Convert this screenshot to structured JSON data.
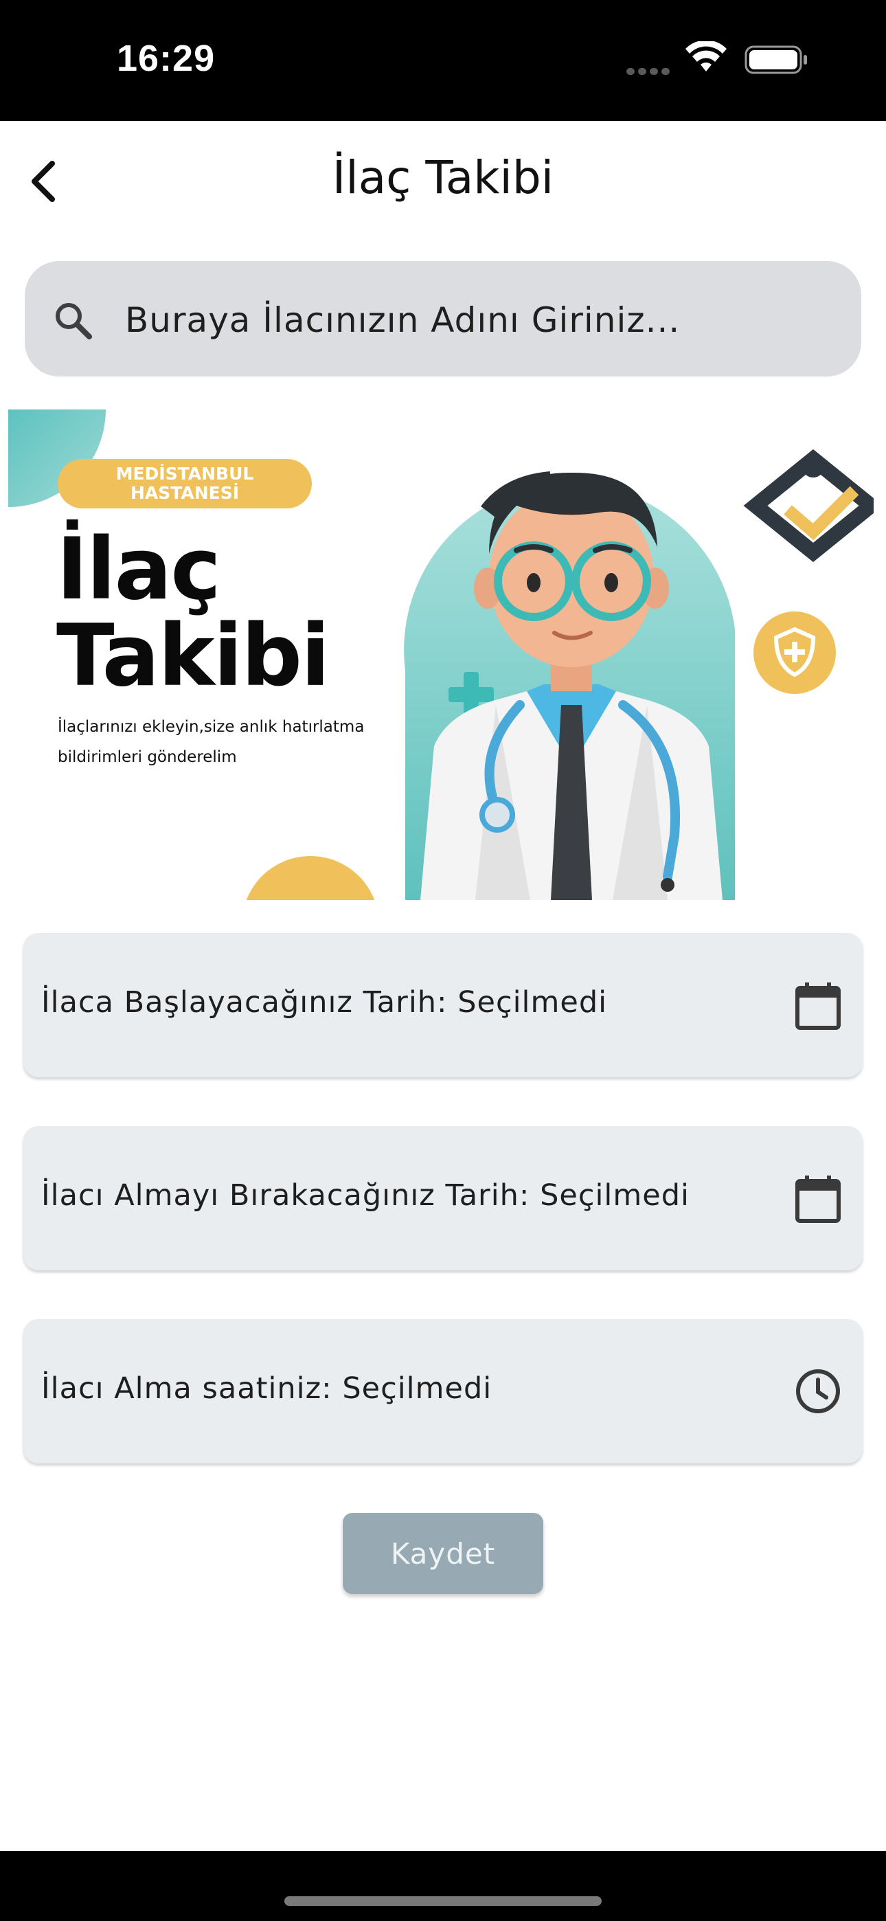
{
  "status_bar": {
    "time": "16:29"
  },
  "header": {
    "title": "İlaç Takibi",
    "back_icon": "chevron-left-icon"
  },
  "search": {
    "placeholder": "Buraya İlacınızın Adını Giriniz...",
    "icon": "search-icon"
  },
  "banner": {
    "badge_text": "MEDİSTANBUL\nHASTANESİ",
    "title": "İlaç\nTakibi",
    "subtitle": "İlaçlarınızı ekleyin,size anlık hatırlatma bildirimleri gönderelim",
    "colors": {
      "teal": "#5dc2bf",
      "gold": "#f0c15b"
    }
  },
  "fields": [
    {
      "label": "İlaca Başlayacağınız Tarih: Seçilmedi",
      "icon": "calendar-icon"
    },
    {
      "label": "İlacı Almayı Bırakacağınız Tarih: Seçilmedi",
      "icon": "calendar-icon"
    },
    {
      "label": "İlacı Alma saatiniz: Seçilmedi",
      "icon": "clock-icon"
    }
  ],
  "actions": {
    "save_label": "Kaydet"
  }
}
